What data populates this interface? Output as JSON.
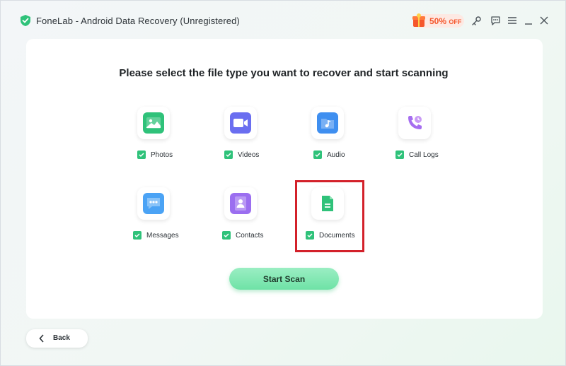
{
  "window": {
    "title": "FoneLab - Android Data Recovery (Unregistered)",
    "promo": {
      "value": "50%",
      "suffix": "OFF"
    },
    "toolbar_icons": [
      "key-icon",
      "feedback-icon",
      "menu-icon",
      "minimize-icon",
      "close-icon"
    ]
  },
  "main": {
    "heading": "Please select the file type you want to recover and start scanning",
    "file_types": [
      {
        "label": "Photos",
        "icon": "photos-icon",
        "color": "#2fc27a",
        "checked": true
      },
      {
        "label": "Videos",
        "icon": "videos-icon",
        "color": "#6a6ef0",
        "checked": true
      },
      {
        "label": "Audio",
        "icon": "audio-icon",
        "color": "#3f8ff0",
        "checked": true
      },
      {
        "label": "Call Logs",
        "icon": "call-logs-icon",
        "color": "#a66ef0",
        "checked": true
      },
      {
        "label": "Messages",
        "icon": "messages-icon",
        "color": "#4ba3f5",
        "checked": true
      },
      {
        "label": "Contacts",
        "icon": "contacts-icon",
        "color": "#9b6ef0",
        "checked": true
      },
      {
        "label": "Documents",
        "icon": "documents-icon",
        "color": "#2fc27a",
        "checked": true
      }
    ],
    "start_button": "Start Scan"
  },
  "footer": {
    "back_label": "Back"
  },
  "colors": {
    "accent": "#2fc27a",
    "highlight": "#d3212a",
    "promo": "#f5572c"
  }
}
